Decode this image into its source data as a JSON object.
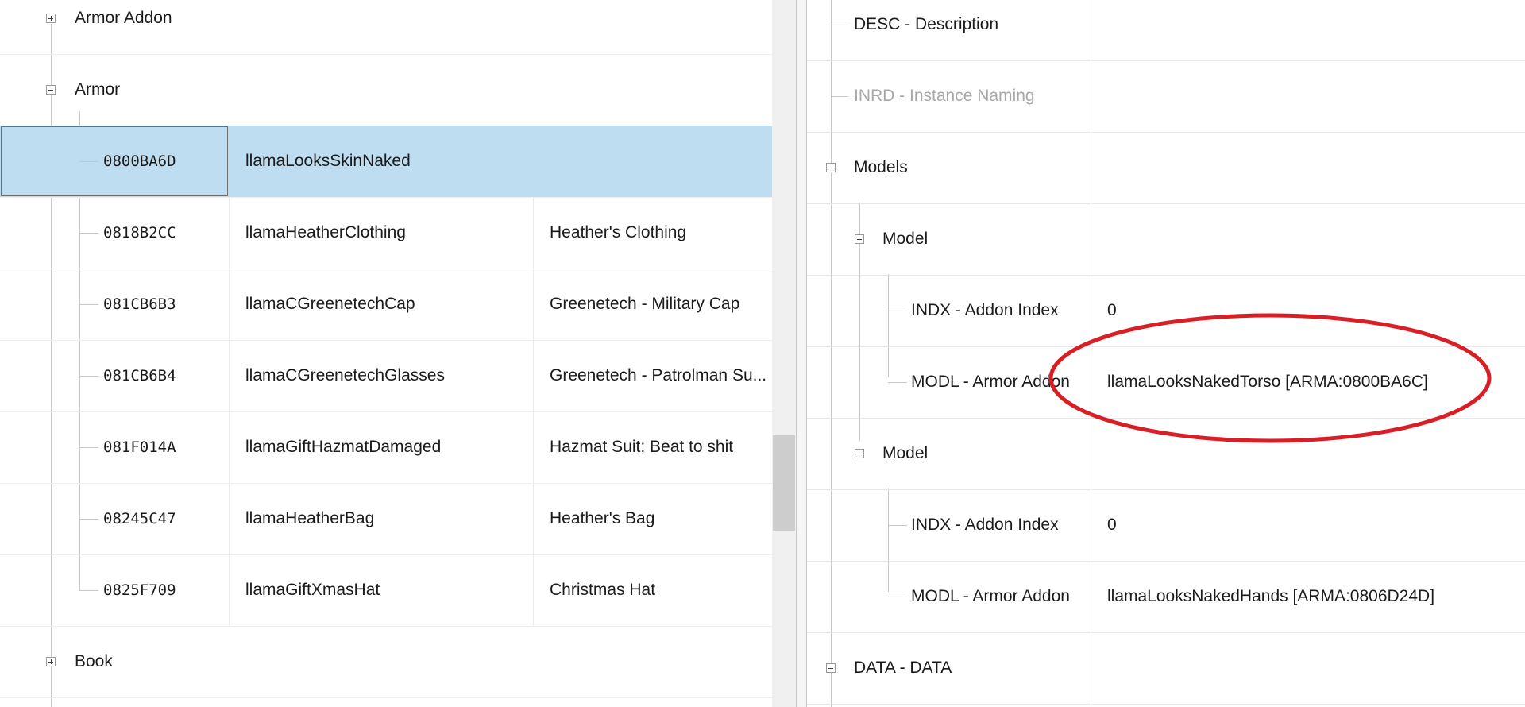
{
  "left_tree": {
    "groups": {
      "armor_addon": "Armor Addon",
      "armor": "Armor",
      "book": "Book"
    },
    "rows": [
      {
        "form_id": "0800BA6D",
        "editor_id": "llamaLooksSkinNaked",
        "name": ""
      },
      {
        "form_id": "0818B2CC",
        "editor_id": "llamaHeatherClothing",
        "name": "Heather's Clothing"
      },
      {
        "form_id": "081CB6B3",
        "editor_id": "llamaCGreenetechCap",
        "name": "Greenetech - Military Cap"
      },
      {
        "form_id": "081CB6B4",
        "editor_id": "llamaCGreenetechGlasses",
        "name": "Greenetech - Patrolman Su..."
      },
      {
        "form_id": "081F014A",
        "editor_id": "llamaGiftHazmatDamaged",
        "name": "Hazmat Suit; Beat to shit"
      },
      {
        "form_id": "08245C47",
        "editor_id": "llamaHeatherBag",
        "name": "Heather's Bag"
      },
      {
        "form_id": "0825F709",
        "editor_id": "llamaGiftXmasHat",
        "name": "Christmas Hat"
      }
    ],
    "selected_index": 0
  },
  "right_tree": {
    "rows": [
      {
        "label": "DESC - Description",
        "value": ""
      },
      {
        "label": "INRD - Instance Naming",
        "value": ""
      },
      {
        "label": "Models",
        "value": ""
      },
      {
        "label": "Model",
        "value": ""
      },
      {
        "label": "INDX - Addon Index",
        "value": "0"
      },
      {
        "label": "MODL - Armor Addon",
        "value": "llamaLooksNakedTorso [ARMA:0800BA6C]"
      },
      {
        "label": "Model",
        "value": ""
      },
      {
        "label": "INDX - Addon Index",
        "value": "0"
      },
      {
        "label": "MODL - Armor Addon",
        "value": "llamaLooksNakedHands [ARMA:0806D24D]"
      },
      {
        "label": "DATA - DATA",
        "value": ""
      }
    ]
  },
  "colors": {
    "selection": "#bfddf0",
    "annotation": "#d91f26"
  },
  "icons": {
    "expand": "plus-box-icon",
    "collapse": "minus-box-icon"
  }
}
